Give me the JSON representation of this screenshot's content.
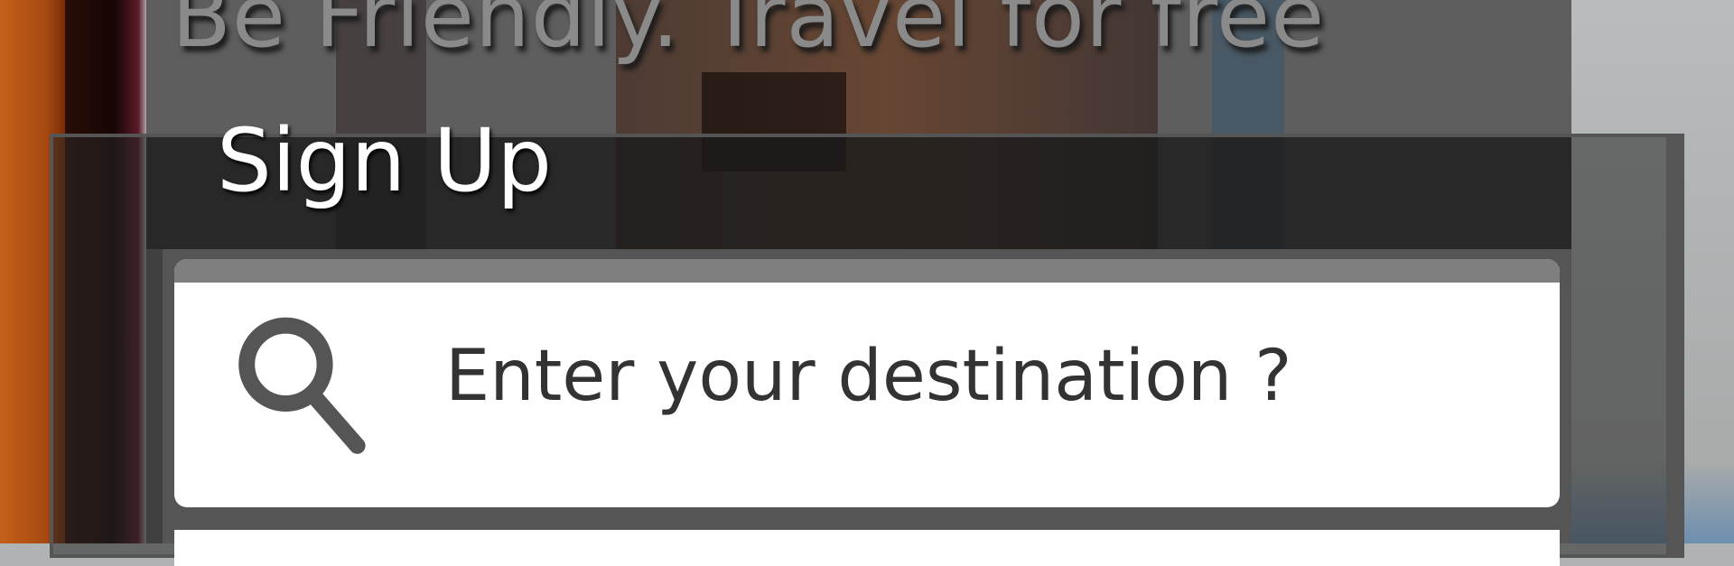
{
  "hero": {
    "headline": "Be Friendly. Travel for free"
  },
  "signup": {
    "title": "Sign Up",
    "search": {
      "placeholder": "Enter your destination ?",
      "value": "",
      "icon": "search-icon"
    }
  },
  "colors": {
    "overlay": "#5e5e5e",
    "title": "#ffffff",
    "input_text": "#333333"
  }
}
